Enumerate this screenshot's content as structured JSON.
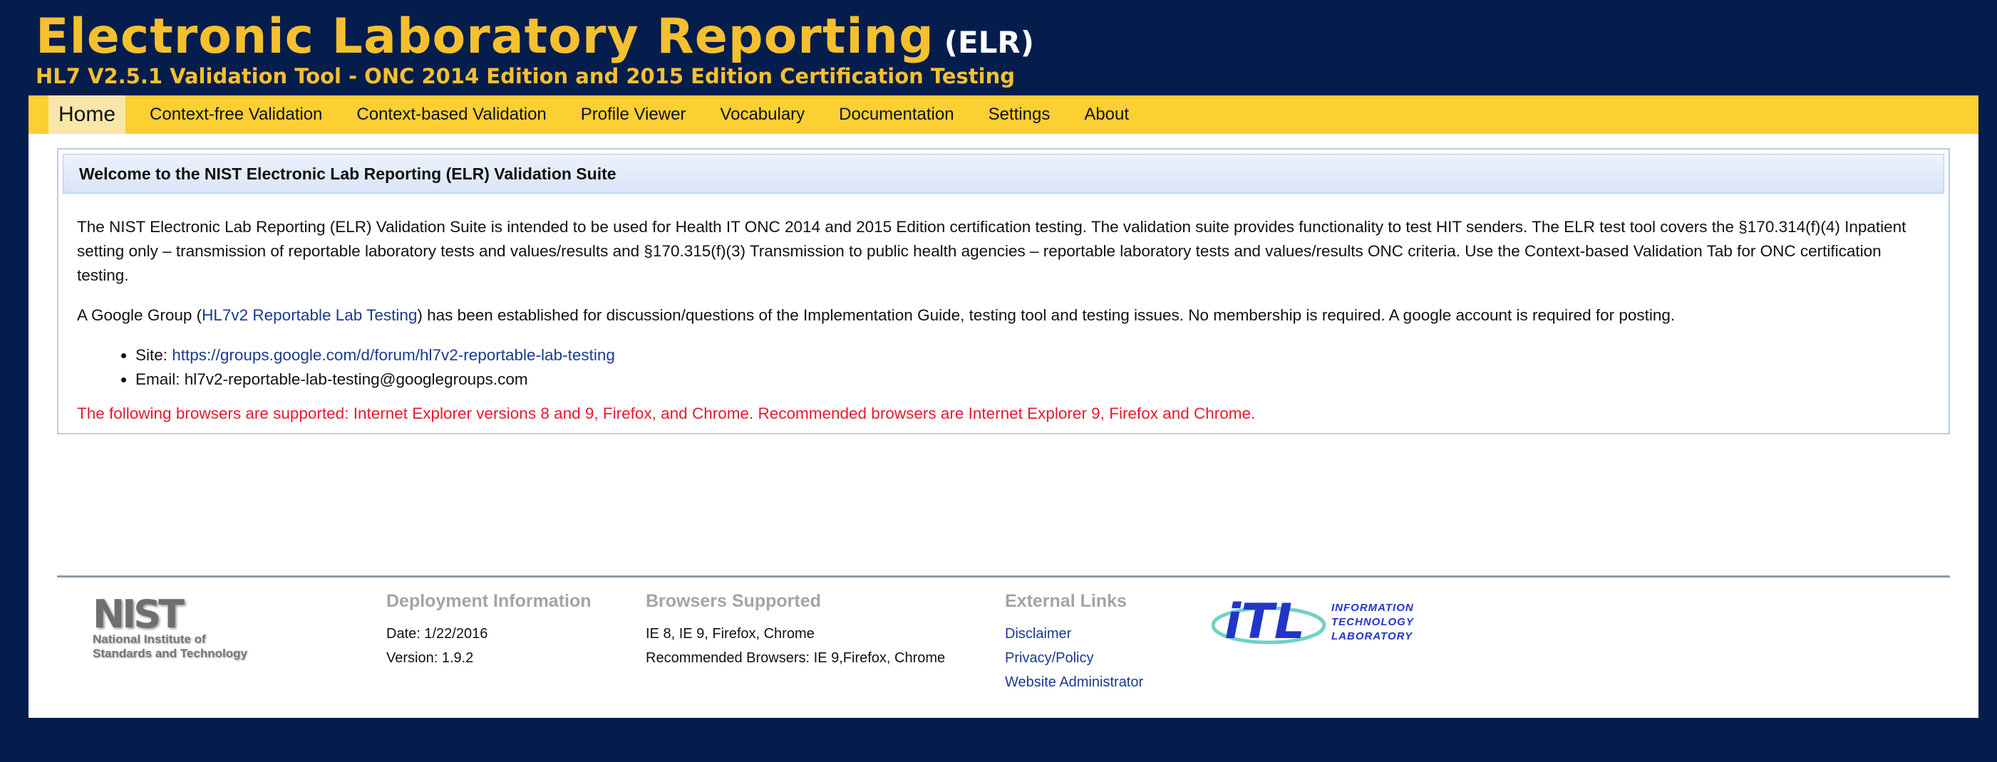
{
  "header": {
    "title": "Electronic Laboratory Reporting",
    "title_abbr": "(ELR)",
    "subtitle": "HL7 V2.5.1 Validation Tool - ONC 2014 Edition and 2015 Edition Certification Testing"
  },
  "nav": {
    "items": [
      {
        "label": "Home",
        "active": true
      },
      {
        "label": "Context-free Validation"
      },
      {
        "label": "Context-based Validation"
      },
      {
        "label": "Profile Viewer"
      },
      {
        "label": "Vocabulary"
      },
      {
        "label": "Documentation"
      },
      {
        "label": "Settings"
      },
      {
        "label": "About"
      }
    ]
  },
  "panel": {
    "heading": "Welcome to the NIST Electronic Lab Reporting (ELR) Validation Suite",
    "intro": "The NIST Electronic Lab Reporting (ELR) Validation Suite is intended to be used for Health IT ONC 2014 and 2015 Edition certification testing. The validation suite provides functionality to test HIT senders. The ELR test tool covers the §170.314(f)(4) Inpatient setting only – transmission of reportable laboratory tests and values/results and §170.315(f)(3) Transmission to public health agencies – reportable laboratory tests and values/results ONC criteria. Use the Context-based Validation Tab for ONC certification testing.",
    "group_prefix": "A Google Group (",
    "group_link": "HL7v2 Reportable Lab Testing",
    "group_suffix": ") has been established for discussion/questions of the Implementation Guide, testing tool and testing issues. No membership is required. A google account is required for posting.",
    "site_label": "Site: ",
    "site_url": "https://groups.google.com/d/forum/hl7v2-reportable-lab-testing",
    "email_label": "Email: hl7v2-reportable-lab-testing@googlegroups.com",
    "browsers_warning": "The following browsers are supported: Internet Explorer versions 8 and 9, Firefox, and Chrome. Recommended browsers are Internet Explorer 9, Firefox and Chrome."
  },
  "footer": {
    "nist_logo": {
      "word": "NIST",
      "line1": "National Institute of",
      "line2": "Standards and Technology"
    },
    "deployment": {
      "heading": "Deployment Information",
      "date": "Date: 1/22/2016",
      "version": "Version: 1.9.2"
    },
    "browsers": {
      "heading": "Browsers Supported",
      "supported": "IE 8, IE 9, Firefox, Chrome",
      "recommended": "Recommended Browsers: IE 9,Firefox, Chrome"
    },
    "external": {
      "heading": "External Links",
      "links": [
        "Disclaimer",
        "Privacy/Policy",
        "Website Administrator"
      ]
    },
    "itl_logo": {
      "mark": "iTL",
      "line1": "INFORMATION",
      "line2": "TECHNOLOGY",
      "line3": "LABORATORY"
    }
  },
  "colors": {
    "background": "#041d4d",
    "title": "#f5c02f",
    "nav": "#fccf32",
    "link": "#1a3a8f",
    "warning": "#e8192e"
  }
}
